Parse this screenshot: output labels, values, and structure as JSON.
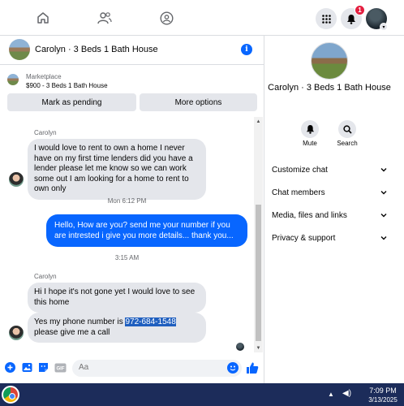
{
  "topnav": {
    "notification_count": "1"
  },
  "chat": {
    "header_title": "Carolyn · 3 Beds 1 Bath House",
    "marketplace_label": "Marketplace",
    "marketplace_item": "$900 - 3 Beds 1 Bath House",
    "mark_pending_label": "Mark as pending",
    "more_options_label": "More options",
    "messages": {
      "sender1": "Carolyn",
      "msg1": "I would love to rent to own a home I never have on my first time lenders did you have a lender please let me know so we can work some out I am looking for a home to rent to own only",
      "time1": "Mon 6:12 PM",
      "out1": "Hello, How are you? send me your number if you are intrested i give you more details... thank you...",
      "time2": "3:15 AM",
      "sender2": "Carolyn",
      "msg2": "Hi I hope it's not gone yet I would love to see this home",
      "msg3_prefix": "Yes my phone number is ",
      "msg3_phone": "972-684-1548",
      "msg3_suffix": " please give me a call"
    },
    "composer_placeholder": "Aa"
  },
  "info_panel": {
    "title": "Carolyn · 3 Beds 1 Bath House",
    "mute_label": "Mute",
    "search_label": "Search",
    "menu": [
      "Customize chat",
      "Chat members",
      "Media, files and links",
      "Privacy & support"
    ]
  },
  "taskbar": {
    "time": "7:09 PM",
    "date": "3/13/2025"
  },
  "colors": {
    "accent": "#0866ff",
    "bubble_in": "#e4e6eb",
    "taskbar": "#1c2c5a"
  }
}
